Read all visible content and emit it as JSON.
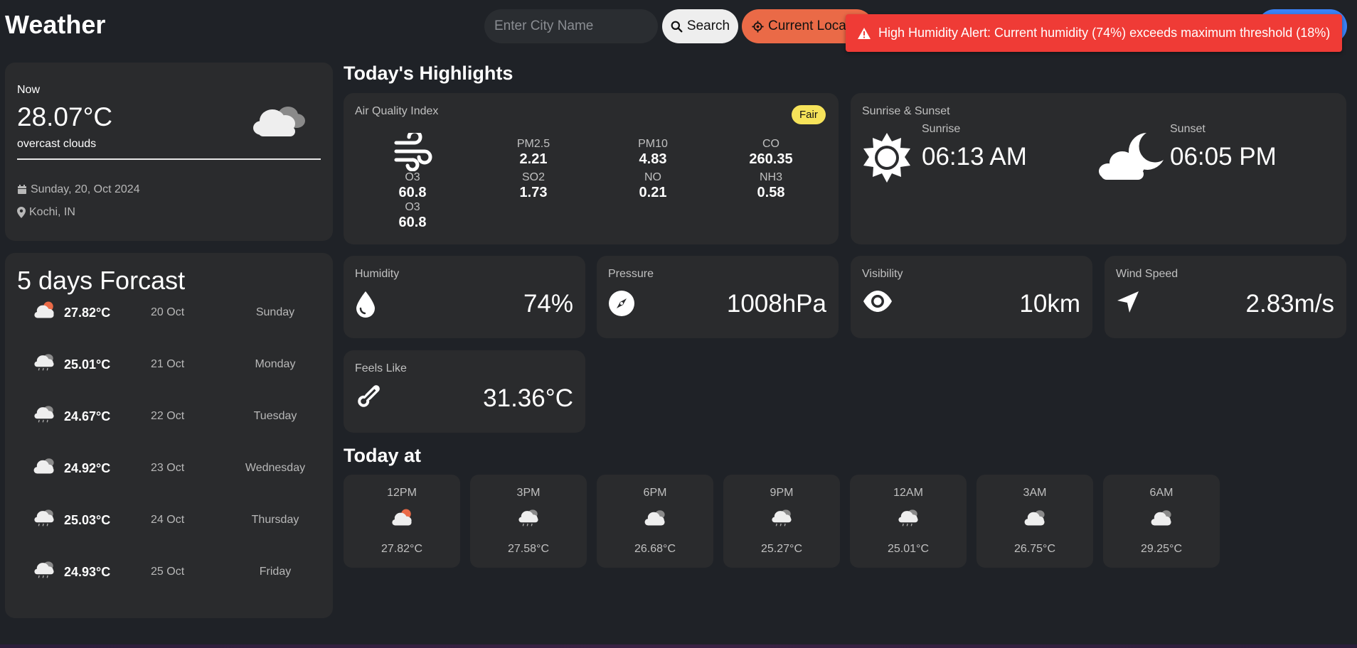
{
  "header": {
    "title": "Weather",
    "search_placeholder": "Enter City Name",
    "search_label": "Search",
    "location_label": "Current Location"
  },
  "alert": {
    "text": "High Humidity Alert: Current humidity (74%) exceeds maximum threshold (18%)",
    "color": "#ef3b36"
  },
  "current": {
    "label": "Now",
    "temp": "28.07°C",
    "description": "overcast clouds",
    "date": "Sunday, 20, Oct 2024",
    "location": "Kochi, IN",
    "icon": "overcast-clouds-icon"
  },
  "forecast": {
    "title": "5 days Forcast",
    "days": [
      {
        "temp": "27.82°C",
        "date": "20 Oct",
        "day": "Sunday",
        "icon": "cloud-sun-icon"
      },
      {
        "temp": "25.01°C",
        "date": "21 Oct",
        "day": "Monday",
        "icon": "rain-cloud-icon"
      },
      {
        "temp": "24.67°C",
        "date": "22 Oct",
        "day": "Tuesday",
        "icon": "rain-cloud-icon"
      },
      {
        "temp": "24.92°C",
        "date": "23 Oct",
        "day": "Wednesday",
        "icon": "cloud-icon"
      },
      {
        "temp": "25.03°C",
        "date": "24 Oct",
        "day": "Thursday",
        "icon": "rain-cloud-icon"
      },
      {
        "temp": "24.93°C",
        "date": "25 Oct",
        "day": "Friday",
        "icon": "rain-cloud-icon"
      }
    ]
  },
  "highlights": {
    "title": "Today's Highlights",
    "aqi": {
      "label": "Air Quality Index",
      "badge": "Fair",
      "badge_color": "#f6e35a",
      "items": [
        {
          "key": "PM2.5",
          "value": "2.21"
        },
        {
          "key": "PM10",
          "value": "4.83"
        },
        {
          "key": "CO",
          "value": "260.35"
        },
        {
          "key": "O3",
          "value": "60.8"
        },
        {
          "key": "SO2",
          "value": "1.73"
        },
        {
          "key": "NO",
          "value": "0.21"
        },
        {
          "key": "NH3",
          "value": "0.58"
        },
        {
          "key": "O3",
          "value": "60.8"
        }
      ]
    },
    "sun": {
      "label": "Sunrise & Sunset",
      "sunrise_label": "Sunrise",
      "sunrise_time": "06:13 AM",
      "sunset_label": "Sunset",
      "sunset_time": "06:05 PM"
    },
    "humidity": {
      "label": "Humidity",
      "value": "74%"
    },
    "pressure": {
      "label": "Pressure",
      "value": "1008hPa"
    },
    "visibility": {
      "label": "Visibility",
      "value": "10km"
    },
    "wind": {
      "label": "Wind Speed",
      "value": "2.83m/s"
    },
    "feels_like": {
      "label": "Feels Like",
      "value": "31.36°C"
    }
  },
  "today": {
    "title": "Today at",
    "hours": [
      {
        "time": "12PM",
        "temp": "27.82°C",
        "icon": "cloud-sun-icon"
      },
      {
        "time": "3PM",
        "temp": "27.58°C",
        "icon": "rain-cloud-icon"
      },
      {
        "time": "6PM",
        "temp": "26.68°C",
        "icon": "cloud-icon"
      },
      {
        "time": "9PM",
        "temp": "25.27°C",
        "icon": "rain-cloud-icon"
      },
      {
        "time": "12AM",
        "temp": "25.01°C",
        "icon": "rain-cloud-icon"
      },
      {
        "time": "3AM",
        "temp": "26.75°C",
        "icon": "cloud-icon"
      },
      {
        "time": "6AM",
        "temp": "29.25°C",
        "icon": "cloud-icon"
      }
    ]
  }
}
